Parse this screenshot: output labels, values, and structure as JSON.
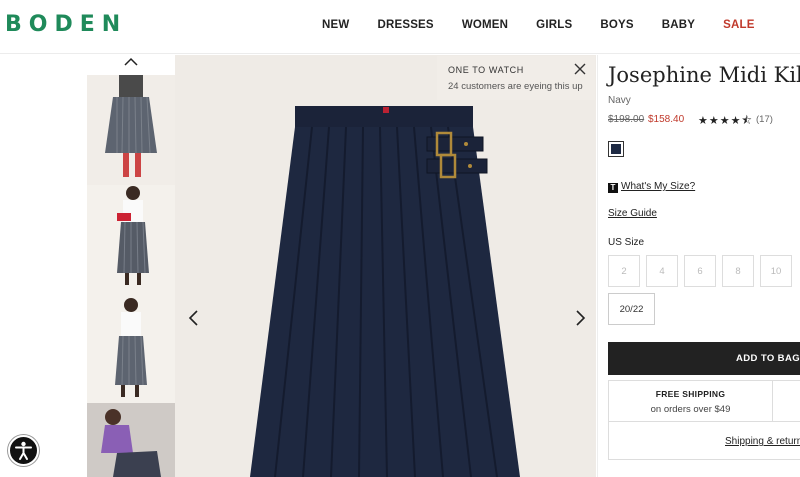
{
  "brand": {
    "logo": "BODEN",
    "accent": "#1f8a5a"
  },
  "nav": [
    {
      "label": "NEW"
    },
    {
      "label": "DRESSES"
    },
    {
      "label": "WOMEN"
    },
    {
      "label": "GIRLS"
    },
    {
      "label": "BOYS"
    },
    {
      "label": "BABY"
    },
    {
      "label": "SALE"
    }
  ],
  "gallery": {
    "up_icon": "chevron-up-icon",
    "prev_icon": "chevron-left-icon",
    "next_icon": "chevron-right-icon"
  },
  "watch": {
    "title": "ONE TO WATCH",
    "subtitle": "24 customers are eyeing this up",
    "close_icon": "close-icon"
  },
  "product": {
    "title": "Josephine Midi Kilt",
    "color": "Navy",
    "price_old": "$198.00",
    "price_new": "$158.40",
    "rating_stars": "★★★★⯪",
    "rating": 4.5,
    "reviews": "(17)",
    "swatch_color": "#1e2a44"
  },
  "sizing": {
    "whats_my_size": "What's My Size?",
    "badge": "T",
    "size_guide": "Size Guide",
    "us_size_label": "US Size",
    "sizes": [
      "2",
      "4",
      "6",
      "8",
      "10",
      "20/22"
    ]
  },
  "cart": {
    "add_label": "ADD TO BAG"
  },
  "shipping": {
    "title": "FREE SHIPPING",
    "subtitle": "on orders over $49",
    "link": "Shipping & returns"
  }
}
